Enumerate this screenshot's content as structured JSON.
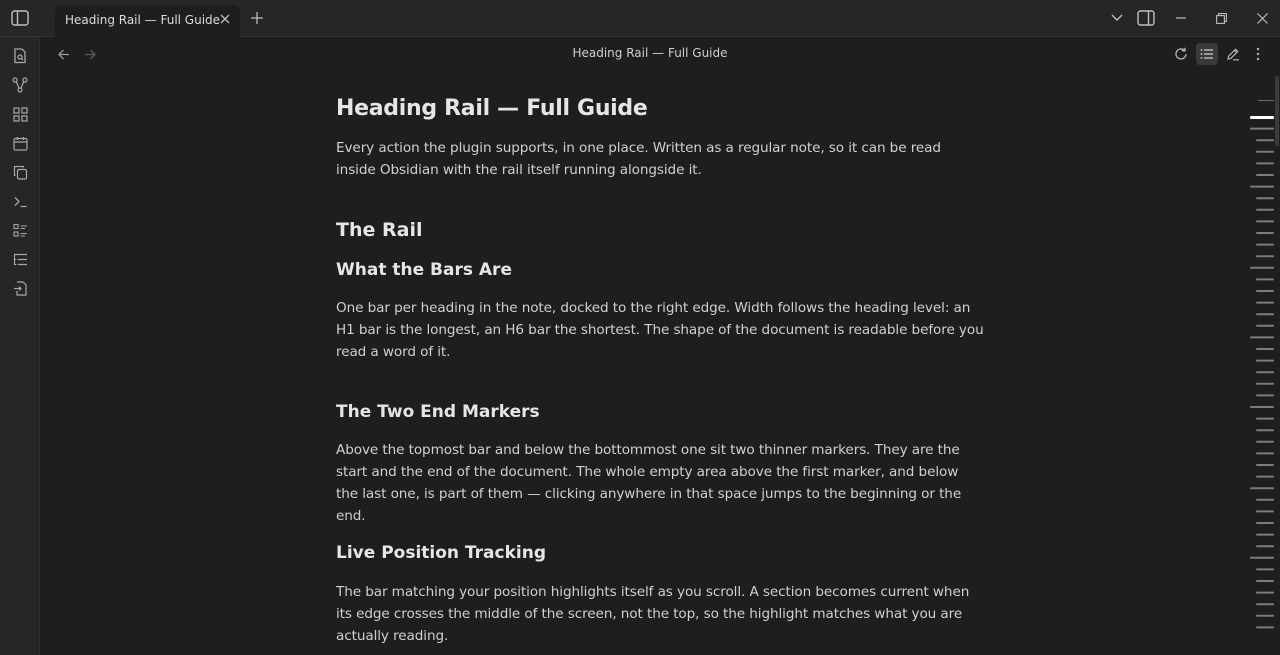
{
  "tab": {
    "title": "Heading Rail — Full Guide"
  },
  "header": {
    "title": "Heading Rail — Full Guide"
  },
  "icons": {
    "sidebar_toggle": "sidebar-toggle-icon",
    "close": "close-icon",
    "new_tab": "plus-icon",
    "tab_list": "chevron-down-icon",
    "right_sidebar": "right-sidebar-icon",
    "minimize": "minimize-icon",
    "restore": "restore-icon",
    "window_close": "window-close-icon"
  },
  "note": {
    "title": "Heading Rail — Full Guide",
    "intro": "Every action the plugin supports, in one place. Written as a regular note, so it can be read inside Obsidian with the rail itself running alongside it.",
    "section1": "The Rail",
    "sub1": "What the Bars Are",
    "sub1_body": "One bar per heading in the note, docked to the right edge. Width follows the heading level: an H1 bar is the longest, an H6 bar the shortest. The shape of the document is readable before you read a word of it.",
    "sub2": "The Two End Markers",
    "sub2_body": "Above the topmost bar and below the bottommost one sit two thinner markers. They are the start and the end of the document. The whole empty area above the first marker, and below the last one, is part of them — clicking anywhere in that space jumps to the beginning or the end.",
    "sub3": "Live Position Tracking",
    "sub3_body": "The bar matching your position highlights itself as you scroll. A section becomes current when its edge crosses the middle of the screen, not the top, so the highlight matches what you are actually reading."
  },
  "rail": {
    "active_index": 0,
    "levels": [
      1,
      2,
      3,
      3,
      3,
      3,
      2,
      3,
      3,
      3,
      3,
      3,
      3,
      2,
      3,
      3,
      3,
      3,
      3,
      2,
      3,
      3,
      3,
      3,
      3,
      2,
      3,
      3,
      3,
      3,
      3,
      3,
      2,
      3,
      3,
      3,
      3,
      3,
      2,
      3,
      3,
      3,
      3,
      3,
      3
    ]
  }
}
